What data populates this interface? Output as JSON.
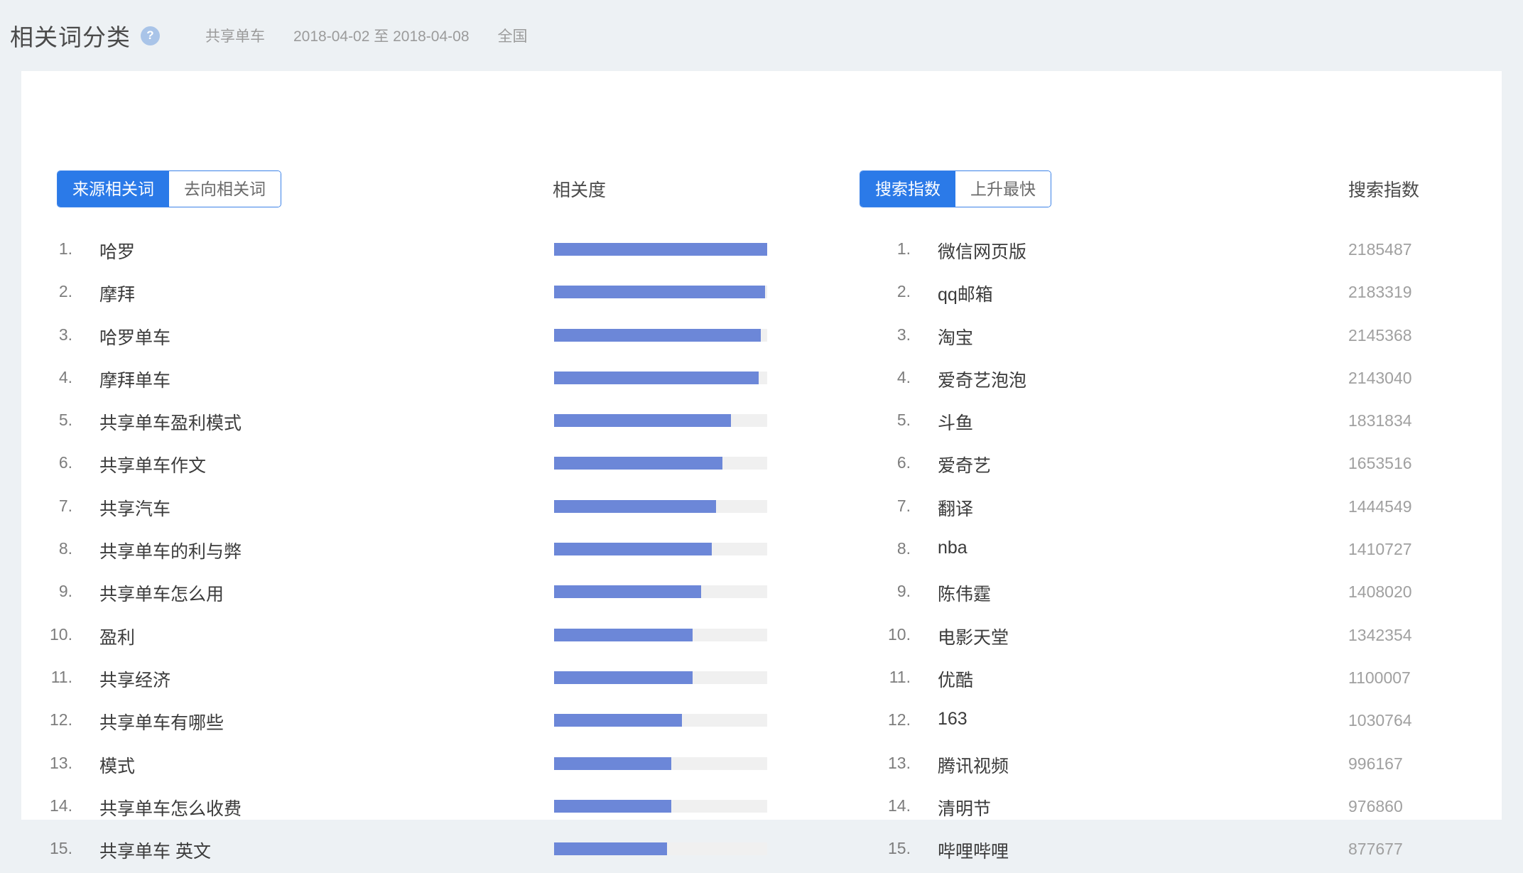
{
  "header": {
    "title": "相关词分类",
    "help_icon": "question-mark-icon",
    "keyword": "共享单车",
    "date_range": "2018-04-02 至 2018-04-08",
    "region": "全国"
  },
  "toolbar": {
    "left_toggle": {
      "options": [
        "来源相关词",
        "去向相关词"
      ],
      "active": "来源相关词"
    },
    "right_toggle": {
      "options": [
        "搜索指数",
        "上升最快"
      ],
      "active": "搜索指数"
    },
    "relevance_header": "相关度",
    "index_header": "搜索指数"
  },
  "chart_data": {
    "type": "bar",
    "title": "相关词分类",
    "xlabel": "相关度",
    "ylabel": "",
    "orientation": "horizontal",
    "grid": false,
    "legend": "none",
    "xlim": [
      0,
      100
    ],
    "categories": [
      "哈罗",
      "摩拜",
      "哈罗单车",
      "摩拜单车",
      "共享单车盈利模式",
      "共享单车作文",
      "共享汽车",
      "共享单车的利与弊",
      "共享单车怎么用",
      "盈利",
      "共享经济",
      "共享单车有哪些",
      "模式",
      "共享单车怎么收费",
      "共享单车 英文"
    ],
    "values": [
      100,
      99,
      97,
      96,
      83,
      79,
      76,
      74,
      69,
      65,
      65,
      60,
      55,
      55,
      53
    ]
  },
  "source_related_list": {
    "ranks": [
      "1.",
      "2.",
      "3.",
      "4.",
      "5.",
      "6.",
      "7.",
      "8.",
      "9.",
      "10.",
      "11.",
      "12.",
      "13.",
      "14.",
      "15."
    ],
    "items": [
      {
        "rank": "1.",
        "term": "哈罗",
        "relevance": 100
      },
      {
        "rank": "2.",
        "term": "摩拜",
        "relevance": 99
      },
      {
        "rank": "3.",
        "term": "哈罗单车",
        "relevance": 97
      },
      {
        "rank": "4.",
        "term": "摩拜单车",
        "relevance": 96
      },
      {
        "rank": "5.",
        "term": "共享单车盈利模式",
        "relevance": 83
      },
      {
        "rank": "6.",
        "term": "共享单车作文",
        "relevance": 79
      },
      {
        "rank": "7.",
        "term": "共享汽车",
        "relevance": 76
      },
      {
        "rank": "8.",
        "term": "共享单车的利与弊",
        "relevance": 74
      },
      {
        "rank": "9.",
        "term": "共享单车怎么用",
        "relevance": 69
      },
      {
        "rank": "10.",
        "term": "盈利",
        "relevance": 65
      },
      {
        "rank": "11.",
        "term": "共享经济",
        "relevance": 65
      },
      {
        "rank": "12.",
        "term": "共享单车有哪些",
        "relevance": 60
      },
      {
        "rank": "13.",
        "term": "模式",
        "relevance": 55
      },
      {
        "rank": "14.",
        "term": "共享单车怎么收费",
        "relevance": 55
      },
      {
        "rank": "15.",
        "term": "共享单车 英文",
        "relevance": 53
      }
    ]
  },
  "search_index_list": {
    "items": [
      {
        "rank": "1.",
        "term": "微信网页版",
        "value": "2185487"
      },
      {
        "rank": "2.",
        "term": "qq邮箱",
        "value": "2183319"
      },
      {
        "rank": "3.",
        "term": "淘宝",
        "value": "2145368"
      },
      {
        "rank": "4.",
        "term": "爱奇艺泡泡",
        "value": "2143040"
      },
      {
        "rank": "5.",
        "term": "斗鱼",
        "value": "1831834"
      },
      {
        "rank": "6.",
        "term": "爱奇艺",
        "value": "1653516"
      },
      {
        "rank": "7.",
        "term": "翻译",
        "value": "1444549"
      },
      {
        "rank": "8.",
        "term": "nba",
        "value": "1410727"
      },
      {
        "rank": "9.",
        "term": "陈伟霆",
        "value": "1408020"
      },
      {
        "rank": "10.",
        "term": "电影天堂",
        "value": "1342354"
      },
      {
        "rank": "11.",
        "term": "优酷",
        "value": "1100007"
      },
      {
        "rank": "12.",
        "term": "163",
        "value": "1030764"
      },
      {
        "rank": "13.",
        "term": "腾讯视频",
        "value": "996167"
      },
      {
        "rank": "14.",
        "term": "清明节",
        "value": "976860"
      },
      {
        "rank": "15.",
        "term": "哔哩哔哩",
        "value": "877677"
      }
    ]
  },
  "colors": {
    "accent": "#2b7ae8",
    "bar_fill": "#6c87d8",
    "bar_track": "#f0f0f0",
    "page_background": "#edf1f4"
  }
}
